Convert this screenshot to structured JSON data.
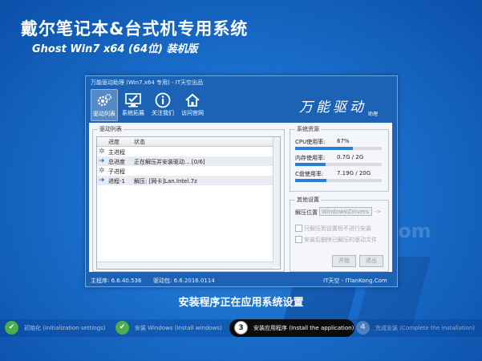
{
  "desktop": {
    "title": "戴尔笔记本&台式机专用系统",
    "subtitle": "Ghost Win7 x64 (64位) 装机版",
    "watermark": "ITianKong 4.com"
  },
  "window": {
    "title": "万能驱动助理 (Win7.x64 专用) - IT天空出品",
    "toolbar": [
      {
        "label": "驱动列表",
        "icon": "gears-icon"
      },
      {
        "label": "系统拓展",
        "icon": "monitor-check-icon"
      },
      {
        "label": "关注我们",
        "icon": "info-icon"
      },
      {
        "label": "访问官网",
        "icon": "home-icon"
      }
    ],
    "brand": "万能驱动",
    "brand_small": "助理",
    "driver_list": {
      "group_label": "驱动列表",
      "columns": [
        "进度",
        "状态"
      ],
      "rows": [
        {
          "name": "主进程",
          "status": "",
          "icon": "gear-icon"
        },
        {
          "name": "总进度",
          "status": "正在解压并安装驱动... [0/6]",
          "icon": "arrow-right-icon"
        },
        {
          "name": "子进程",
          "status": "",
          "icon": "gear-icon"
        },
        {
          "name": "进程-1",
          "status": "解压: [网卡]Lan.Intel.7z",
          "icon": "arrow-right-icon"
        }
      ]
    },
    "resources": {
      "group_label": "系统资源",
      "cpu": {
        "label": "CPU使用率:",
        "value": "67%",
        "fraction": 0.67
      },
      "memory": {
        "label": "内存使用率:",
        "value": "0.7G / 2G",
        "fraction": 0.35
      },
      "disk": {
        "label": "C盘使用率:",
        "value": "7.19G / 20G",
        "fraction": 0.36
      }
    },
    "settings": {
      "group_label": "其他设置",
      "extract_label": "解压位置",
      "extract_value": "Windows\\Drivers",
      "extract_arrow": "->",
      "option1": "只解压到设置但不进行安装",
      "option2": "安装后删除已解压的驱动文件",
      "start_button": "开始",
      "exit_button": "退出"
    },
    "statusbar": {
      "left": "主程序: 6.6.40.536",
      "mid": "驱动包: 6.6.2016.0114",
      "right": "IT天空 - ITianKong.Com"
    }
  },
  "main_status": "安装程序正在应用系统设置",
  "steps": [
    {
      "num": "✔",
      "label": "初始化 (Initialization settings)",
      "state": "done"
    },
    {
      "num": "✔",
      "label": "安装 Windows (Install windows)",
      "state": "done"
    },
    {
      "num": "3",
      "label": "安装应用程序 (Install the application)",
      "state": "active"
    },
    {
      "num": "4",
      "label": "完成安装 (Complete the installation)",
      "state": "pending"
    }
  ],
  "colors": {
    "accent": "#2a7fd6",
    "success": "#4cae4c",
    "background": "#1a6fcc"
  }
}
